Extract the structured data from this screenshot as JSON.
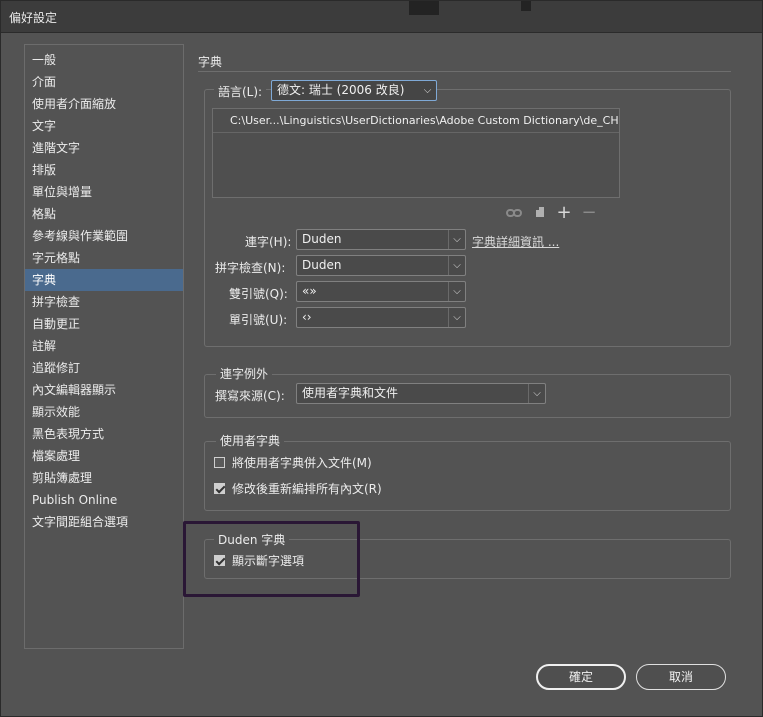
{
  "window": {
    "title": "偏好設定"
  },
  "sidebar": {
    "items": [
      {
        "label": "一般"
      },
      {
        "label": "介面"
      },
      {
        "label": "使用者介面縮放"
      },
      {
        "label": "文字"
      },
      {
        "label": "進階文字"
      },
      {
        "label": "排版"
      },
      {
        "label": "單位與增量"
      },
      {
        "label": "格點"
      },
      {
        "label": "參考線與作業範圍"
      },
      {
        "label": "字元格點"
      },
      {
        "label": "字典",
        "selected": true
      },
      {
        "label": "拼字檢查"
      },
      {
        "label": "自動更正"
      },
      {
        "label": "註解"
      },
      {
        "label": "追蹤修訂"
      },
      {
        "label": "內文編輯器顯示"
      },
      {
        "label": "顯示效能"
      },
      {
        "label": "黑色表現方式"
      },
      {
        "label": "檔案處理"
      },
      {
        "label": "剪貼簿處理"
      },
      {
        "label": "Publish Online"
      },
      {
        "label": "文字間距組合選項"
      }
    ]
  },
  "main": {
    "section_title": "字典",
    "language": {
      "label": "語言(L):",
      "value": "德文: 瑞士 (2006 改良)"
    },
    "dictionary_list": [
      "C:\\User...\\Linguistics\\UserDictionaries\\Adobe Custom Dictionary\\de_CH"
    ],
    "dictionary_icons": [
      "link-icon",
      "new-page-icon",
      "plus-icon",
      "minus-icon"
    ],
    "hyphenation": {
      "label": "連字(H):",
      "value": "Duden",
      "link": "字典詳細資訊 ..."
    },
    "spelling": {
      "label": "拼字檢查(N):",
      "value": "Duden"
    },
    "double_quotes": {
      "label": "雙引號(Q):",
      "value": "«»"
    },
    "single_quotes": {
      "label": "單引號(U):",
      "value": "‹›"
    },
    "hyphen_exceptions": {
      "legend": "連字例外",
      "compose_label": "撰寫來源(C):",
      "compose_value": "使用者字典和文件"
    },
    "user_dictionary": {
      "legend": "使用者字典",
      "merge_label": "將使用者字典併入文件(M)",
      "merge_checked": false,
      "recompose_label": "修改後重新編排所有內文(R)",
      "recompose_checked": true
    },
    "duden": {
      "legend": "Duden 字典",
      "show_label": "顯示斷字選項",
      "show_checked": true
    }
  },
  "footer": {
    "ok": "確定",
    "cancel": "取消"
  }
}
